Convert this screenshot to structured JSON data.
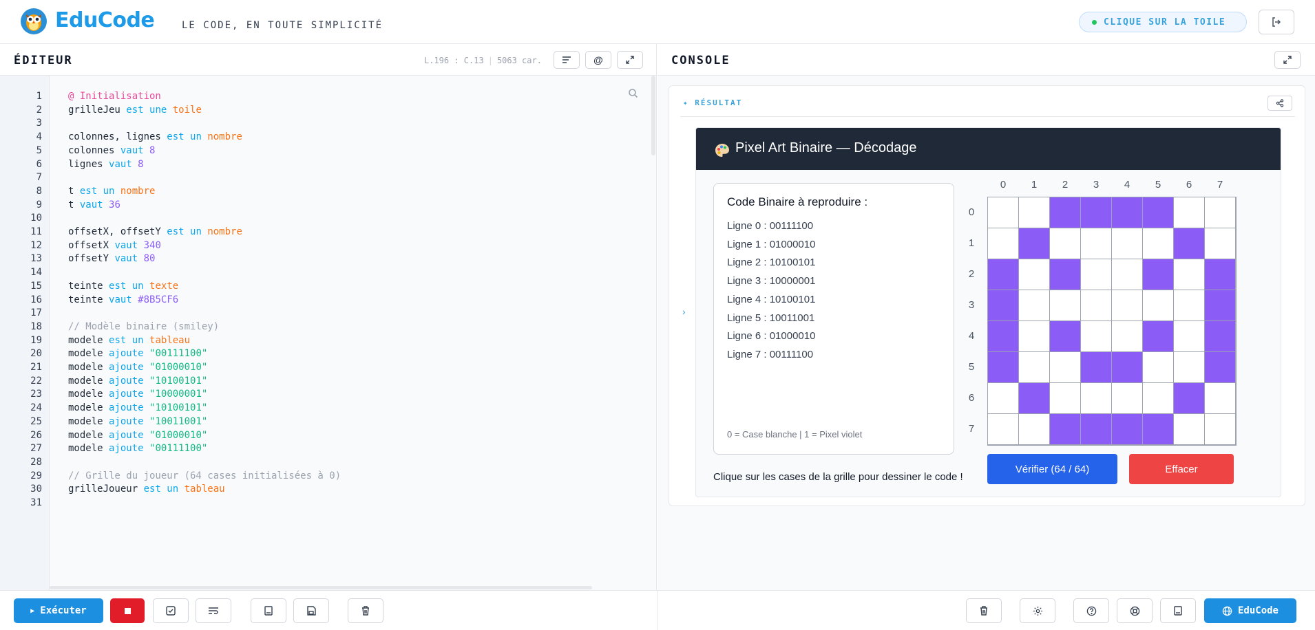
{
  "header": {
    "logo_text": "EduCode",
    "tagline": "LE CODE, EN TOUTE SIMPLICITÉ",
    "status_pill": "CLIQUE SUR LA TOILE",
    "status_color": "#22c55e"
  },
  "editor": {
    "title": "ÉDITEUR",
    "cursor": "L.196 : C.13",
    "char_count": "5063 car.",
    "lines": [
      {
        "n": "1",
        "tokens": [
          {
            "t": "@ Initialisation",
            "c": "at"
          }
        ]
      },
      {
        "n": "2",
        "tokens": [
          {
            "t": "grilleJeu "
          },
          {
            "t": "est une",
            "c": "kw"
          },
          {
            "t": " "
          },
          {
            "t": "toile",
            "c": "ty"
          }
        ]
      },
      {
        "n": "3",
        "tokens": []
      },
      {
        "n": "4",
        "tokens": [
          {
            "t": "colonnes, lignes "
          },
          {
            "t": "est un",
            "c": "kw"
          },
          {
            "t": " "
          },
          {
            "t": "nombre",
            "c": "ty"
          }
        ]
      },
      {
        "n": "5",
        "tokens": [
          {
            "t": "colonnes "
          },
          {
            "t": "vaut",
            "c": "kw"
          },
          {
            "t": " "
          },
          {
            "t": "8",
            "c": "num"
          }
        ]
      },
      {
        "n": "6",
        "tokens": [
          {
            "t": "lignes "
          },
          {
            "t": "vaut",
            "c": "kw"
          },
          {
            "t": " "
          },
          {
            "t": "8",
            "c": "num"
          }
        ]
      },
      {
        "n": "7",
        "tokens": []
      },
      {
        "n": "8",
        "tokens": [
          {
            "t": "t "
          },
          {
            "t": "est un",
            "c": "kw"
          },
          {
            "t": " "
          },
          {
            "t": "nombre",
            "c": "ty"
          }
        ]
      },
      {
        "n": "9",
        "tokens": [
          {
            "t": "t "
          },
          {
            "t": "vaut",
            "c": "kw"
          },
          {
            "t": " "
          },
          {
            "t": "36",
            "c": "num"
          }
        ]
      },
      {
        "n": "10",
        "tokens": []
      },
      {
        "n": "11",
        "tokens": [
          {
            "t": "offsetX, offsetY "
          },
          {
            "t": "est un",
            "c": "kw"
          },
          {
            "t": " "
          },
          {
            "t": "nombre",
            "c": "ty"
          }
        ]
      },
      {
        "n": "12",
        "tokens": [
          {
            "t": "offsetX "
          },
          {
            "t": "vaut",
            "c": "kw"
          },
          {
            "t": " "
          },
          {
            "t": "340",
            "c": "num"
          }
        ]
      },
      {
        "n": "13",
        "tokens": [
          {
            "t": "offsetY "
          },
          {
            "t": "vaut",
            "c": "kw"
          },
          {
            "t": " "
          },
          {
            "t": "80",
            "c": "num"
          }
        ]
      },
      {
        "n": "14",
        "tokens": []
      },
      {
        "n": "15",
        "tokens": [
          {
            "t": "teinte "
          },
          {
            "t": "est un",
            "c": "kw"
          },
          {
            "t": " "
          },
          {
            "t": "texte",
            "c": "ty"
          }
        ]
      },
      {
        "n": "16",
        "tokens": [
          {
            "t": "teinte "
          },
          {
            "t": "vaut",
            "c": "kw"
          },
          {
            "t": " "
          },
          {
            "t": "#8B5CF6",
            "c": "num"
          }
        ]
      },
      {
        "n": "17",
        "tokens": []
      },
      {
        "n": "18",
        "tokens": [
          {
            "t": "// Modèle binaire (smiley)",
            "c": "cm"
          }
        ]
      },
      {
        "n": "19",
        "tokens": [
          {
            "t": "modele "
          },
          {
            "t": "est un",
            "c": "kw"
          },
          {
            "t": " "
          },
          {
            "t": "tableau",
            "c": "ty"
          }
        ]
      },
      {
        "n": "20",
        "tokens": [
          {
            "t": "modele "
          },
          {
            "t": "ajoute",
            "c": "kw"
          },
          {
            "t": " "
          },
          {
            "t": "\"00111100\"",
            "c": "str"
          }
        ]
      },
      {
        "n": "21",
        "tokens": [
          {
            "t": "modele "
          },
          {
            "t": "ajoute",
            "c": "kw"
          },
          {
            "t": " "
          },
          {
            "t": "\"01000010\"",
            "c": "str"
          }
        ]
      },
      {
        "n": "22",
        "tokens": [
          {
            "t": "modele "
          },
          {
            "t": "ajoute",
            "c": "kw"
          },
          {
            "t": " "
          },
          {
            "t": "\"10100101\"",
            "c": "str"
          }
        ]
      },
      {
        "n": "23",
        "tokens": [
          {
            "t": "modele "
          },
          {
            "t": "ajoute",
            "c": "kw"
          },
          {
            "t": " "
          },
          {
            "t": "\"10000001\"",
            "c": "str"
          }
        ]
      },
      {
        "n": "24",
        "tokens": [
          {
            "t": "modele "
          },
          {
            "t": "ajoute",
            "c": "kw"
          },
          {
            "t": " "
          },
          {
            "t": "\"10100101\"",
            "c": "str"
          }
        ]
      },
      {
        "n": "25",
        "tokens": [
          {
            "t": "modele "
          },
          {
            "t": "ajoute",
            "c": "kw"
          },
          {
            "t": " "
          },
          {
            "t": "\"10011001\"",
            "c": "str"
          }
        ]
      },
      {
        "n": "26",
        "tokens": [
          {
            "t": "modele "
          },
          {
            "t": "ajoute",
            "c": "kw"
          },
          {
            "t": " "
          },
          {
            "t": "\"01000010\"",
            "c": "str"
          }
        ]
      },
      {
        "n": "27",
        "tokens": [
          {
            "t": "modele "
          },
          {
            "t": "ajoute",
            "c": "kw"
          },
          {
            "t": " "
          },
          {
            "t": "\"00111100\"",
            "c": "str"
          }
        ]
      },
      {
        "n": "28",
        "tokens": []
      },
      {
        "n": "29",
        "tokens": [
          {
            "t": "// Grille du joueur (64 cases initialisées à 0)",
            "c": "cm"
          }
        ]
      },
      {
        "n": "30",
        "tokens": [
          {
            "t": "grilleJoueur "
          },
          {
            "t": "est un",
            "c": "kw"
          },
          {
            "t": " "
          },
          {
            "t": "tableau",
            "c": "ty"
          }
        ]
      },
      {
        "n": "31",
        "tokens": []
      }
    ]
  },
  "console": {
    "title": "CONSOLE",
    "result_label": "RÉSULTAT",
    "app": {
      "title": "Pixel Art Binaire — Décodage",
      "code_box_title": "Code Binaire à reproduire :",
      "code_rows": [
        "Ligne 0 : 00111100",
        "Ligne 1 : 01000010",
        "Ligne 2 : 10100101",
        "Ligne 3 : 10000001",
        "Ligne 4 : 10100101",
        "Ligne 5 : 10011001",
        "Ligne 6 : 01000010",
        "Ligne 7 : 00111100"
      ],
      "legend": "0 = Case blanche | 1 = Pixel violet",
      "hint": "Clique sur les cases de la grille pour dessiner le code !",
      "col_labels": [
        "0",
        "1",
        "2",
        "3",
        "4",
        "5",
        "6",
        "7"
      ],
      "row_labels": [
        "0",
        "1",
        "2",
        "3",
        "4",
        "5",
        "6",
        "7"
      ],
      "grid_rows": [
        "00111100",
        "01000010",
        "10100101",
        "10000001",
        "10100101",
        "10011001",
        "01000010",
        "00111100"
      ],
      "pixel_color": "#8B5CF6",
      "verify_label": "Vérifier (64 / 64)",
      "clear_label": "Effacer"
    }
  },
  "footer": {
    "run_label": "Exécuter",
    "educode_label": "EduCode",
    "accent_color": "#1d8fe1",
    "stop_color": "#e11d2a"
  }
}
